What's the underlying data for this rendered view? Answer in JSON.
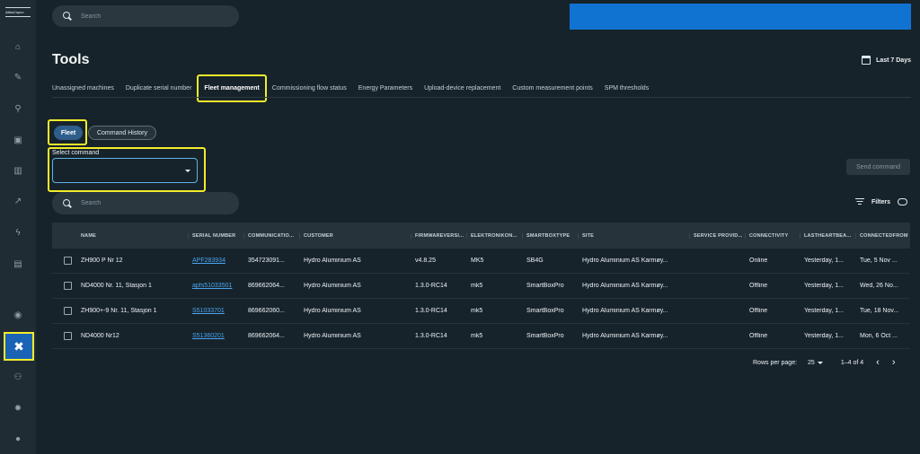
{
  "brand": {
    "logo_text": "AtlasCopco"
  },
  "sidebar": {
    "items": [
      {
        "name": "home",
        "glyph": "⌂"
      },
      {
        "name": "wrench",
        "glyph": "🔧"
      },
      {
        "name": "robot-arm",
        "glyph": "⚙"
      },
      {
        "name": "clipboard",
        "glyph": "▣"
      },
      {
        "name": "bar-chart",
        "glyph": "▥"
      },
      {
        "name": "trend",
        "glyph": "〜"
      },
      {
        "name": "lightning",
        "glyph": "⚡"
      },
      {
        "name": "message",
        "glyph": "▤"
      },
      {
        "name": "settings-lock",
        "glyph": "◉"
      },
      {
        "name": "tools",
        "glyph": "✖"
      },
      {
        "name": "add-user",
        "glyph": "👤"
      },
      {
        "name": "gear",
        "glyph": "⚙"
      },
      {
        "name": "help",
        "glyph": "?"
      }
    ]
  },
  "header": {
    "search_placeholder": "Search",
    "banner_color": "#1173d1"
  },
  "page": {
    "title": "Tools",
    "date_range": "Last 7 Days"
  },
  "tabs": [
    {
      "label": "Unassigned machines",
      "active": false
    },
    {
      "label": "Duplicate serial number",
      "active": false
    },
    {
      "label": "Fleet management",
      "active": true
    },
    {
      "label": "Commissioning flow status",
      "active": false
    },
    {
      "label": "Energy Parameters",
      "active": false
    },
    {
      "label": "Upload-device replacement",
      "active": false
    },
    {
      "label": "Custom measurement points",
      "active": false
    },
    {
      "label": "SPM thresholds",
      "active": false
    }
  ],
  "subtabs": {
    "fleet": "Fleet",
    "history": "Command History"
  },
  "command": {
    "label": "Select command",
    "value": "",
    "send_label": "Send command"
  },
  "table_search": {
    "placeholder": "Search"
  },
  "filters_label": "Filters",
  "table": {
    "columns": [
      "NAME",
      "SERIAL NUMBER",
      "COMMUNICATIO...",
      "CUSTOMER",
      "FIRMWAREVERSI...",
      "ELEKTRONIKON...",
      "SMARTBOXTYPE",
      "SITE",
      "SERVICE PROVID...",
      "CONNECTIVITY",
      "LASTHEARTBEA...",
      "CONNECTEDFROM"
    ],
    "rows": [
      [
        "ZH900 P Nr 12",
        "APF283934",
        "354723091...",
        "Hydro Aluminium AS",
        "v4.8.25",
        "MK5",
        "SB4G",
        "Hydro Aluminium AS Karmøy...",
        "",
        "Online",
        "Yesterday, 1...",
        "Tue, 5 Nov ..."
      ],
      [
        "ND4000 Nr. 11, Stasjon 1",
        "apfs51033501",
        "869662064...",
        "Hydro Aluminium AS",
        "1.3.0-RC14",
        "mk5",
        "SmartBoxPro",
        "Hydro Aluminium AS Karmøy...",
        "",
        "Offline",
        "Yesterday, 1...",
        "Wed, 26 No..."
      ],
      [
        "ZH900+-9 Nr. 11, Stasjon 1",
        "S51033701",
        "869662060...",
        "Hydro Aluminium AS",
        "1.3.0-RC14",
        "mk5",
        "SmartBoxPro",
        "Hydro Aluminium AS Karmøy...",
        "",
        "Offline",
        "Yesterday, 1...",
        "Tue, 18 Nov..."
      ],
      [
        "ND4000 Nr12",
        "S51360201",
        "869662064...",
        "Hydro Aluminium AS",
        "1.3.0-RC14",
        "mk5",
        "SmartBoxPro",
        "Hydro Aluminium AS Karmøy...",
        "",
        "Offline",
        "Yesterday, 1...",
        "Mon, 6 Oct ..."
      ]
    ]
  },
  "pagination": {
    "rows_per_page_label": "Rows per page:",
    "rows_per_page": "25",
    "range": "1–4 of 4",
    "prev": "‹",
    "next": "›"
  },
  "colors": {
    "accent": "#1a63b5",
    "highlight": "#f3ec2b",
    "link": "#4aa4ee",
    "background": "#17232b"
  }
}
